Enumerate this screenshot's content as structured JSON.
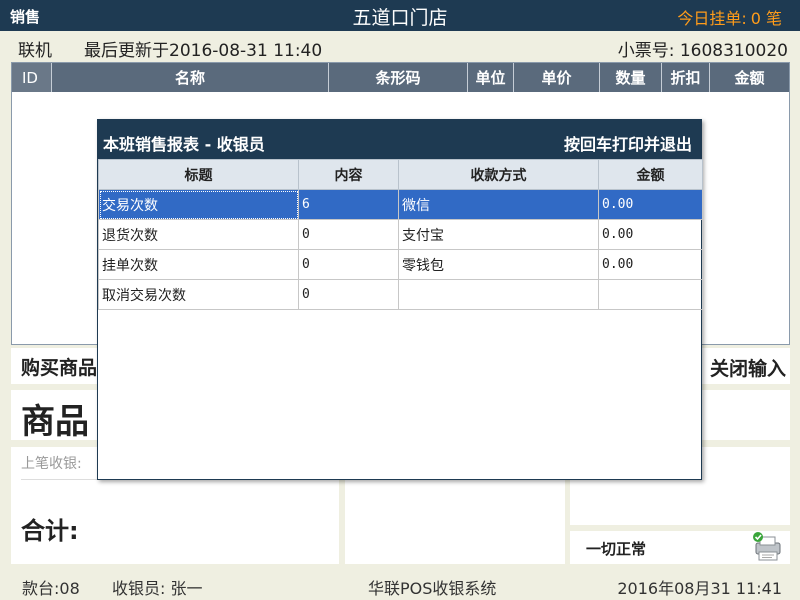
{
  "topbar": {
    "mode": "销售",
    "store_name": "五道口门店",
    "held_label": "今日挂单:",
    "held_count": "0 笔"
  },
  "info": {
    "status": "联机",
    "last_update": "最后更新于2016-08-31  11:40",
    "receipt_no": "小票号: 1608310020"
  },
  "sales_table": {
    "columns": [
      "ID",
      "名称",
      "条形码",
      "单位",
      "单价",
      "数量",
      "折扣",
      "金额"
    ]
  },
  "panels": {
    "buy_label": "购买商品",
    "close_input": "关闭输入",
    "item_label": "商品",
    "last_checkout": "上笔收银:",
    "total_label": "合计:",
    "status_ok": "一切正常"
  },
  "statusbar": {
    "terminal": "款台:08",
    "cashier": "收银员: 张一",
    "system": "华联POS收银系统",
    "datetime": "2016年08月31  11:41"
  },
  "modal": {
    "title": "本班销售报表 - 收银员",
    "hint": "按回车打印并退出",
    "columns": [
      "标题",
      "内容",
      "收款方式",
      "金额"
    ],
    "rows": [
      [
        "交易次数",
        "6",
        "微信",
        "0.00"
      ],
      [
        "退货次数",
        "0",
        "支付宝",
        "0.00"
      ],
      [
        "挂单次数",
        "0",
        "零钱包",
        "0.00"
      ],
      [
        "取消交易次数",
        "0",
        "",
        ""
      ]
    ],
    "selected_row": 0
  },
  "colors": {
    "header_bg": "#1e3a52",
    "accent_orange": "#ff9c1a",
    "selection_blue": "#316ac5",
    "background": "#efefe1"
  },
  "icons": {
    "printer": "printer-status-icon"
  }
}
